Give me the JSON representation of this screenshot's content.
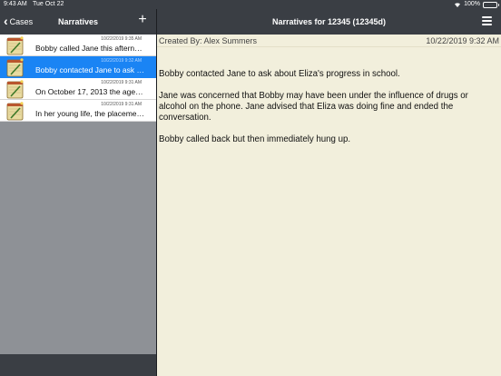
{
  "status_bar": {
    "time": "9:43 AM",
    "date": "Tue Oct 22",
    "battery": "100%"
  },
  "left_nav": {
    "back_label": "Cases",
    "title": "Narratives",
    "add_icon": "plus-icon"
  },
  "narratives": [
    {
      "timestamp": "10/22/2019 9:35 AM",
      "preview": "Bobby called Jane this afternoon...",
      "selected": false
    },
    {
      "timestamp": "10/22/2019 9:32 AM",
      "preview": "Bobby contacted Jane to ask about Eliza's progress in school.",
      "selected": true
    },
    {
      "timestamp": "10/22/2019 9:31 AM",
      "preview": "On October 17, 2013 the agency...",
      "selected": false
    },
    {
      "timestamp": "10/22/2019 9:31 AM",
      "preview": "In her young life, the placement...",
      "selected": false
    }
  ],
  "right_nav": {
    "title": "Narratives for 12345 (12345d)",
    "menu_icon": "hamburger-menu-icon"
  },
  "detail": {
    "created_by": "Created By: Alex Summers",
    "date": "10/22/2019 9:32 AM",
    "paragraphs": [
      "Bobby contacted Jane to ask about Eliza's progress in school.",
      "Jane was concerned that Bobby may have been under the influence of drugs or alcohol on the phone. Jane advised that Eliza was doing fine and ended the conversation.",
      "Bobby called back but then immediately hung up."
    ]
  },
  "colors": {
    "nav_bar": "#3a3e44",
    "selected_row": "#1a84f4",
    "detail_background": "#f2efdc",
    "list_background": "#8e9196"
  }
}
